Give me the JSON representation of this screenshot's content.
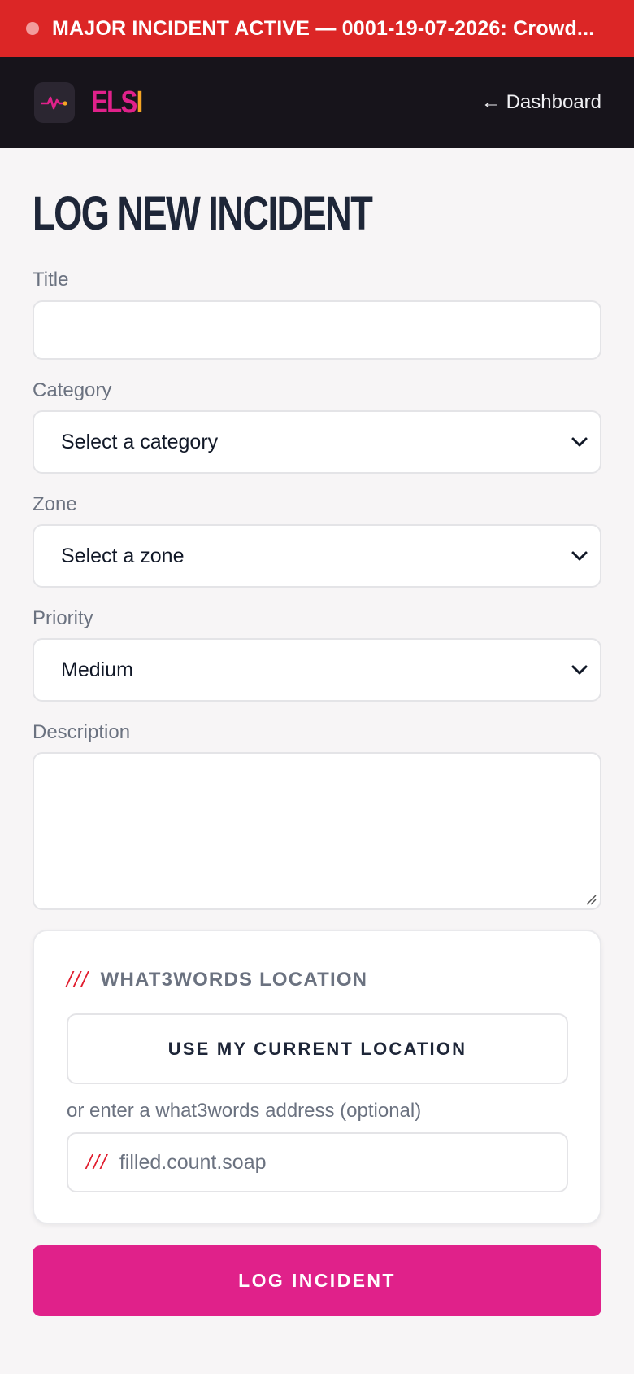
{
  "banner": {
    "text": "MAJOR INCIDENT ACTIVE — 0001-19-07-2026: Crowd..."
  },
  "header": {
    "brand_main": "ELS",
    "brand_end": "I",
    "back_link": "← Dashboard"
  },
  "page": {
    "title": "LOG NEW INCIDENT"
  },
  "form": {
    "title_label": "Title",
    "title_value": "",
    "category_label": "Category",
    "category_value": "Select a category",
    "zone_label": "Zone",
    "zone_value": "Select a zone",
    "priority_label": "Priority",
    "priority_value": "Medium",
    "description_label": "Description",
    "description_value": ""
  },
  "what3words": {
    "slashes": "///",
    "heading": "WHAT3WORDS LOCATION",
    "use_location_button": "USE MY CURRENT LOCATION",
    "hint": "or enter a what3words address (optional)",
    "input_placeholder": "filled.count.soap"
  },
  "submit": {
    "label": "LOG INCIDENT"
  },
  "colors": {
    "banner": "#dc2626",
    "header": "#17141b",
    "accent": "#e0218a",
    "brand_secondary": "#f5a524",
    "w3_red": "#e11d2e"
  },
  "icons": {
    "logo": "heartbeat-icon",
    "banner_status": "status-dot-icon",
    "dropdown": "chevron-down-icon"
  }
}
